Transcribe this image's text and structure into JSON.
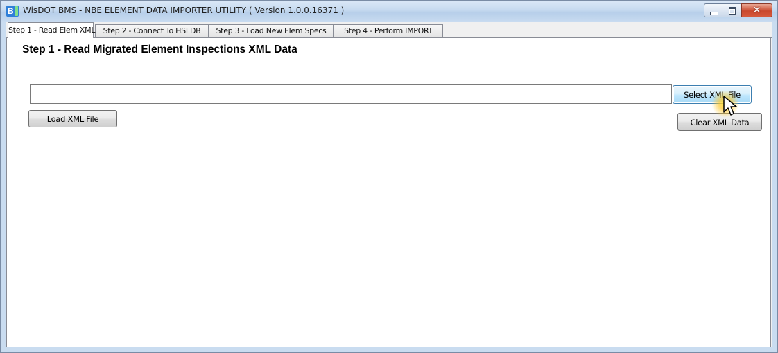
{
  "window": {
    "icon_text": "B",
    "title": "WisDOT BMS - NBE ELEMENT DATA IMPORTER UTILITY ( Version 1.0.0.16371 )",
    "controls": {
      "minimize": "minimize",
      "maximize": "maximize",
      "close": "✕"
    }
  },
  "tabs": [
    {
      "label": "Step 1 - Read Elem XML",
      "active": true
    },
    {
      "label": "Step 2 - Connect To HSI DB",
      "active": false
    },
    {
      "label": "Step 3 - Load New Elem Specs",
      "active": false
    },
    {
      "label": "Step 4 - Perform IMPORT",
      "active": false
    }
  ],
  "step1": {
    "heading": "Step 1 - Read Migrated Element Inspections XML Data",
    "xml_path": {
      "value": "",
      "placeholder": ""
    },
    "select_button": "Select XML File",
    "load_button": "Load XML File",
    "clear_button": "Clear XML Data"
  },
  "colors": {
    "title_bar": "#c5d9ef",
    "accent": "#3c7fb1",
    "close": "#c9482d"
  }
}
